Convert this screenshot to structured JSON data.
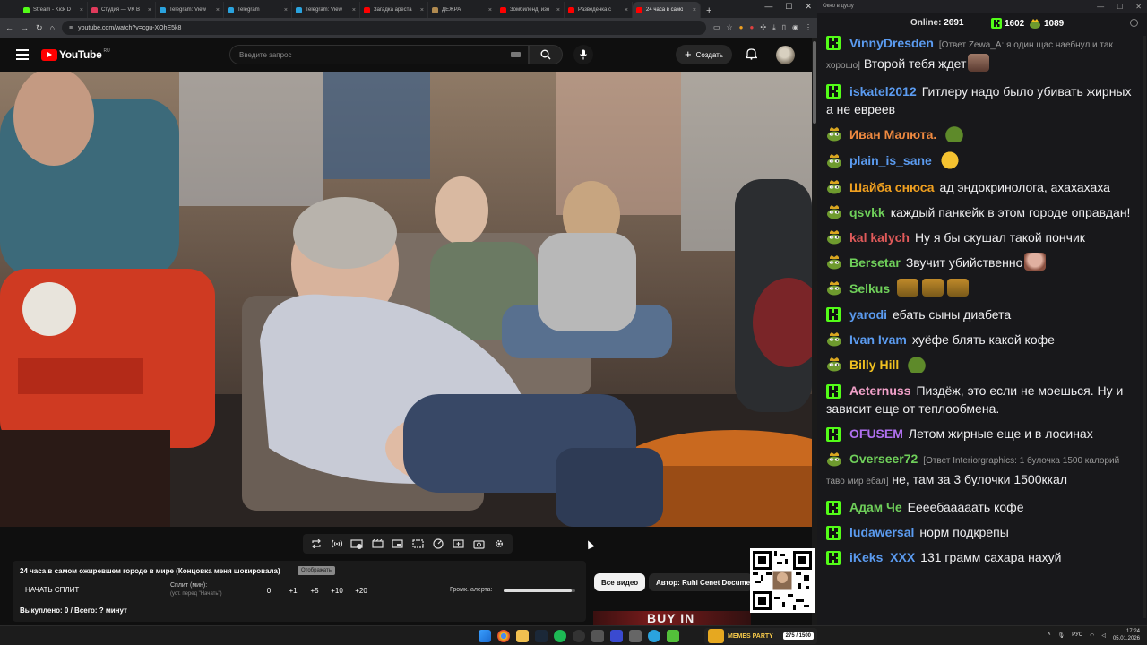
{
  "browser": {
    "tabs": [
      {
        "title": "Stream - Kick D",
        "color": "#53fc18"
      },
      {
        "title": "Студия — VK В",
        "color": "#e03a5b"
      },
      {
        "title": "Telegram: View",
        "color": "#2aa3de"
      },
      {
        "title": "Telegram",
        "color": "#2aa3de"
      },
      {
        "title": "Telegram: View",
        "color": "#2aa3de"
      },
      {
        "title": "Загадка ареста",
        "color": "#ff0000"
      },
      {
        "title": "ДЕЖРА",
        "color": "#b08a50"
      },
      {
        "title": "Зомбиленд, изо",
        "color": "#ff0000"
      },
      {
        "title": "Разведенка с",
        "color": "#ff0000"
      },
      {
        "title": "24 часа в само",
        "color": "#ff0000",
        "active": true
      }
    ],
    "url": "youtube.com/watch?v=cgu-XOhE5k8"
  },
  "youtube": {
    "logo_text": "YouTube",
    "region": "RU",
    "search_placeholder": "Введите запрос",
    "create_label": "Создать"
  },
  "split_panel": {
    "title": "24 часа в самом ожиревшем городе в мире (Концовка меня шокировала)",
    "badge": "Отображать",
    "start_button": "НАЧАТЬ СПЛИТ",
    "split_label": "Сплит (мин):",
    "split_hint": "(уст. перед \"Начать\")",
    "value": "0",
    "increments": [
      "+1",
      "+5",
      "+10",
      "+20"
    ],
    "alert_label": "Громк. алерта:",
    "alert_volume": 0.95,
    "stats": "Выкуплено: 0 / Всего: ? минут"
  },
  "recommend": {
    "all_videos": "Все видео",
    "author": "Автор: Ruhi Cenet Documentaries",
    "thumb_text": "BUY IN"
  },
  "chat": {
    "window_title": "Окно в душу",
    "online_label": "Online:",
    "online_count": "2691",
    "k_count": "1602",
    "p_count": "1089",
    "messages": [
      {
        "badge": "kick",
        "nick": "VinnyDresden",
        "color": "#5b9bf0",
        "reply": "[Ответ Zewa_A: я один щас наебнул и так хорошо]",
        "text": "Второй тебя ждет",
        "emote": "face"
      },
      {
        "badge": "kick",
        "nick": "iskatel2012",
        "color": "#5b9bf0",
        "text": "Гитлеру надо было убивать жирных а не евреев"
      },
      {
        "badge": "pepe",
        "nick": "Иван Малюта.",
        "color": "#f08a40",
        "text": "",
        "emote": "pepe"
      },
      {
        "badge": "pepe",
        "nick": "plain_is_sane",
        "color": "#5b9bf0",
        "text": "",
        "emote": "laugh"
      },
      {
        "badge": "pepe",
        "nick": "Шайба снюса",
        "color": "#f0a020",
        "text": "ад эндокринолога, ахахахаха"
      },
      {
        "badge": "pepe",
        "nick": "qsvkk",
        "color": "#6fcf5a",
        "text": "каждый панкейк в этом городе оправдан!"
      },
      {
        "badge": "pepe",
        "nick": "kal kalych",
        "color": "#e05a5a",
        "text": "Ну я бы скушал такой пончик"
      },
      {
        "badge": "pepe",
        "nick": "Bersetar",
        "color": "#6fcf5a",
        "text": "Звучит убийственно",
        "emote": "face2"
      },
      {
        "badge": "pepe",
        "nick": "Selkus",
        "color": "#6fcf5a",
        "text": "",
        "emote": "triple"
      },
      {
        "badge": "kick",
        "nick": "yarodi",
        "color": "#5b9bf0",
        "text": "ебать сыны диабета"
      },
      {
        "badge": "pepe",
        "nick": "Ivan Ivam",
        "color": "#5b9bf0",
        "text": "хуёфе блять какой кофе"
      },
      {
        "badge": "pepe",
        "nick": "Billy Hill",
        "color": "#f0c020",
        "text": "",
        "emote": "pepe"
      },
      {
        "badge": "kick",
        "nick": "Aeternuss",
        "color": "#f0a0c8",
        "text": "Пиздёж, это если не моешься. Ну и зависит еще от теплообмена."
      },
      {
        "badge": "kick",
        "nick": "OFUSEM",
        "color": "#b070f0",
        "text": "Летом жирные еще и в лосинах"
      },
      {
        "badge": "pepe",
        "nick": "Overseer72",
        "color": "#6fcf5a",
        "reply": "[Ответ Interiorgraphics: 1 булочка 1500 калорий таво мир ебал]",
        "text": "не, там за 3 булочки 1500ккал"
      },
      {
        "badge": "kick",
        "nick": "Адам Че",
        "color": "#6fcf5a",
        "text": "Еееебааааать кофе"
      },
      {
        "badge": "kick",
        "nick": "ludawersal",
        "color": "#5b9bf0",
        "text": "норм подкрепы"
      },
      {
        "badge": "kick",
        "nick": "iKeks_XXX",
        "color": "#5b9bf0",
        "text": "131 грамм сахара нахуй"
      }
    ]
  },
  "taskbar": {
    "banner_title": "MEMES PARTY",
    "banner_count": "275 / 1500",
    "lang": "РУС",
    "time": "17:24",
    "date": "05.01.2026"
  }
}
